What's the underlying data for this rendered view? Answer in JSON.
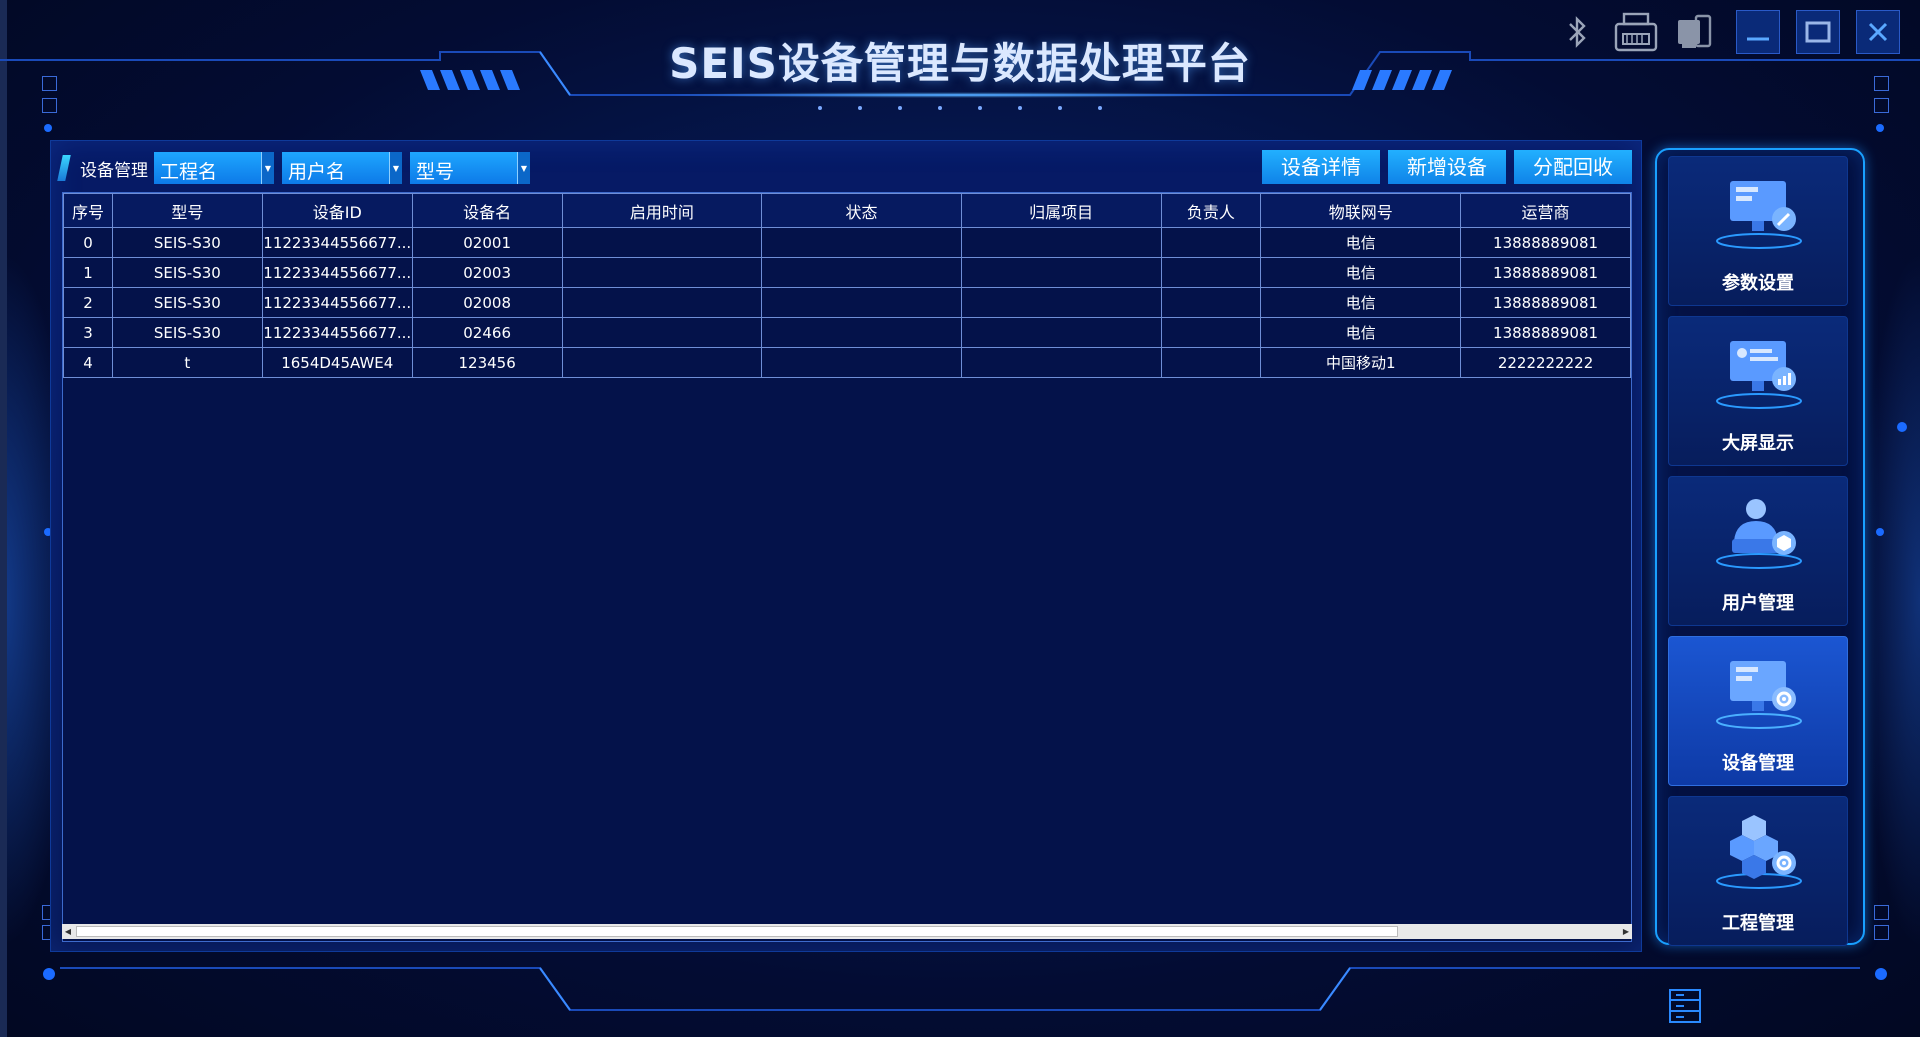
{
  "app": {
    "title": "SEIS设备管理与数据处理平台"
  },
  "window_controls": [
    {
      "name": "bluetooth-icon"
    },
    {
      "name": "printer-icon"
    },
    {
      "name": "device-icon"
    },
    {
      "name": "minimize-button"
    },
    {
      "name": "maximize-button"
    },
    {
      "name": "close-button"
    }
  ],
  "toolbar": {
    "section_label": "设备管理",
    "filters": [
      {
        "value": "工程名"
      },
      {
        "value": "用户名"
      },
      {
        "value": "型号"
      }
    ],
    "actions": [
      {
        "label": "设备详情"
      },
      {
        "label": "新增设备"
      },
      {
        "label": "分配回收"
      }
    ]
  },
  "table": {
    "columns": [
      "序号",
      "型号",
      "设备ID",
      "设备名",
      "启用时间",
      "状态",
      "归属项目",
      "负责人",
      "物联网号",
      "运营商"
    ],
    "rows": [
      [
        "0",
        "SEIS-S30",
        "11223344556677...",
        "02001",
        "",
        "",
        "",
        "",
        "电信",
        "13888889081"
      ],
      [
        "1",
        "SEIS-S30",
        "11223344556677...",
        "02003",
        "",
        "",
        "",
        "",
        "电信",
        "13888889081"
      ],
      [
        "2",
        "SEIS-S30",
        "11223344556677...",
        "02008",
        "",
        "",
        "",
        "",
        "电信",
        "13888889081"
      ],
      [
        "3",
        "SEIS-S30",
        "11223344556677...",
        "02466",
        "",
        "",
        "",
        "",
        "电信",
        "13888889081"
      ],
      [
        "4",
        "t",
        "1654D45AWE4",
        "123456",
        "",
        "",
        "",
        "",
        "中国移动1",
        "2222222222"
      ]
    ]
  },
  "side_menu": {
    "items": [
      {
        "label": "参数设置",
        "icon": "monitor-edit-icon",
        "active": false
      },
      {
        "label": "大屏显示",
        "icon": "monitor-chart-icon",
        "active": false
      },
      {
        "label": "用户管理",
        "icon": "user-laptop-icon",
        "active": false
      },
      {
        "label": "设备管理",
        "icon": "monitor-gear-icon",
        "active": true
      },
      {
        "label": "工程管理",
        "icon": "cubes-gear-icon",
        "active": false
      }
    ]
  },
  "colors": {
    "background": "#020a2a",
    "panel": "#061a66",
    "accent": "#1ea6ff",
    "active_menu": "#1b56d2"
  }
}
